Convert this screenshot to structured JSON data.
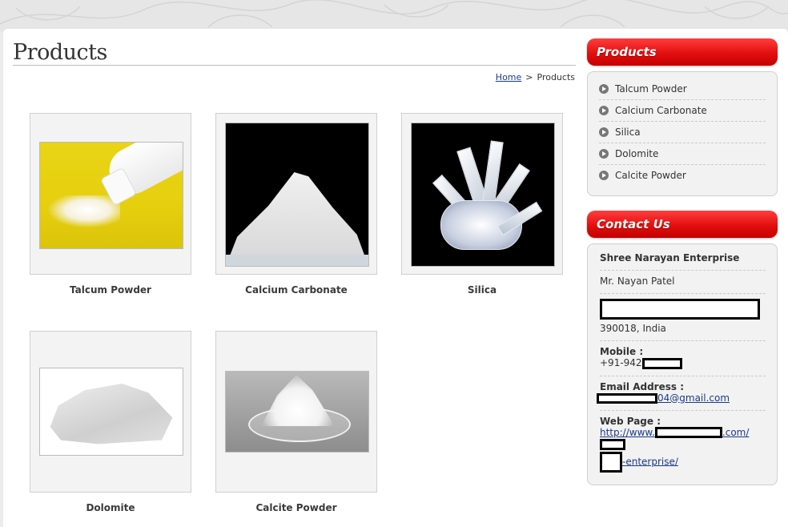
{
  "page": {
    "title": "Products",
    "breadcrumb": {
      "home": "Home",
      "separator": ">",
      "current": "Products"
    }
  },
  "products": [
    {
      "name": "Talcum Powder"
    },
    {
      "name": "Calcium Carbonate"
    },
    {
      "name": "Silica"
    },
    {
      "name": "Dolomite"
    },
    {
      "name": "Calcite Powder"
    }
  ],
  "sidebar": {
    "products_heading": "Products",
    "items": [
      "Talcum Powder",
      "Calcium Carbonate",
      "Silica",
      "Dolomite",
      "Calcite Powder"
    ],
    "contact_heading": "Contact Us",
    "contact": {
      "company": "Shree Narayan Enterprise",
      "person": "Mr. Nayan Patel",
      "address_tail": "390018, India",
      "mobile_label": "Mobile :",
      "mobile_prefix": "+91-942",
      "email_label": "Email Address :",
      "email_suffix": "04@gmail.com",
      "web_label": "Web Page :",
      "web_prefix": "http://www.",
      "web_mid": ".com/",
      "web_suffix": "-enterprise/"
    }
  },
  "colors": {
    "accent": "#e30f0f",
    "link": "#1a3a8a"
  }
}
